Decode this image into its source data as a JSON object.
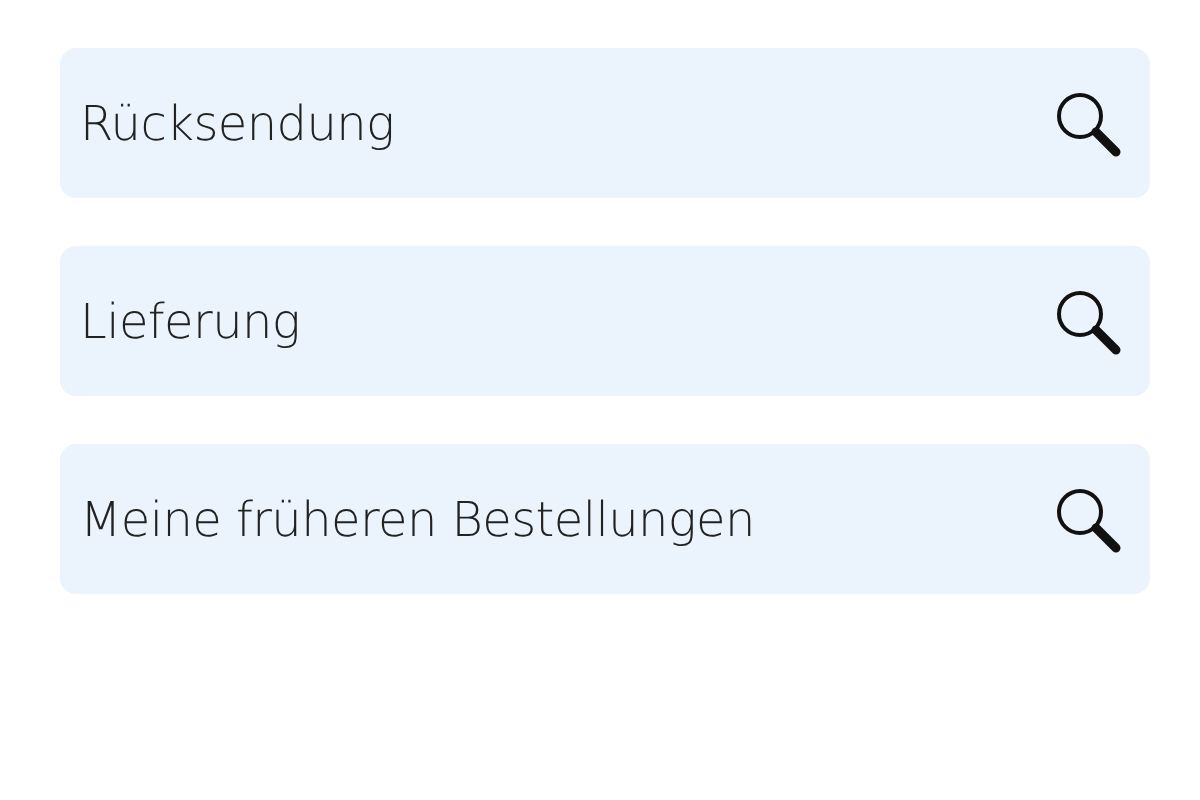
{
  "items": [
    {
      "label": "Rücksendung"
    },
    {
      "label": "Lieferung"
    },
    {
      "label": "Meine früheren Bestellungen"
    }
  ]
}
